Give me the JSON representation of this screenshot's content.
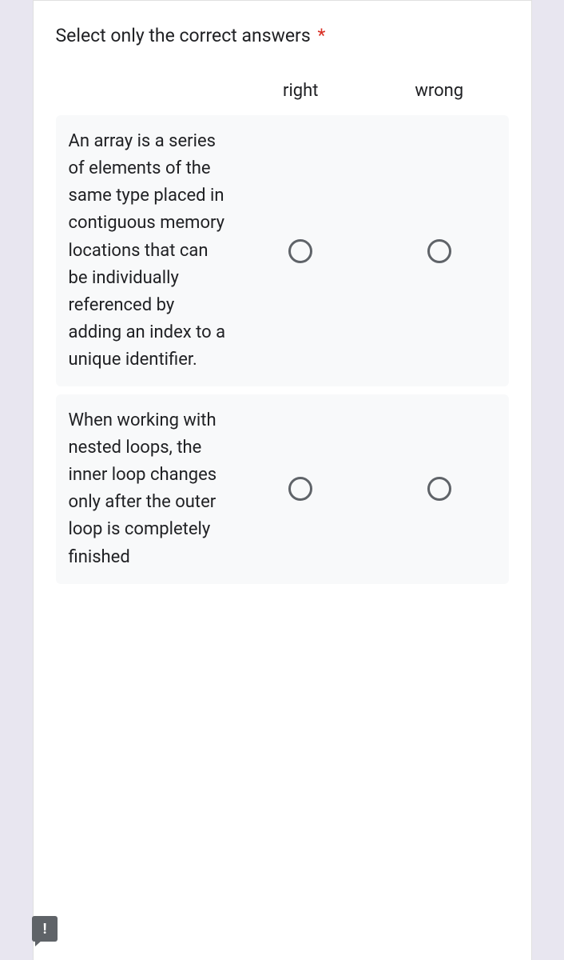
{
  "question": {
    "title": "Select only the correct answers",
    "required_mark": "*",
    "columns": [
      "right",
      "wrong"
    ],
    "rows": [
      "An array is a series of elements of the same type placed in contiguous memory locations that can be individually referenced by adding an index to a unique identifier.",
      "When working with nested loops, the inner loop changes only after the outer loop is completely finished"
    ]
  },
  "feedback_icon": "!"
}
